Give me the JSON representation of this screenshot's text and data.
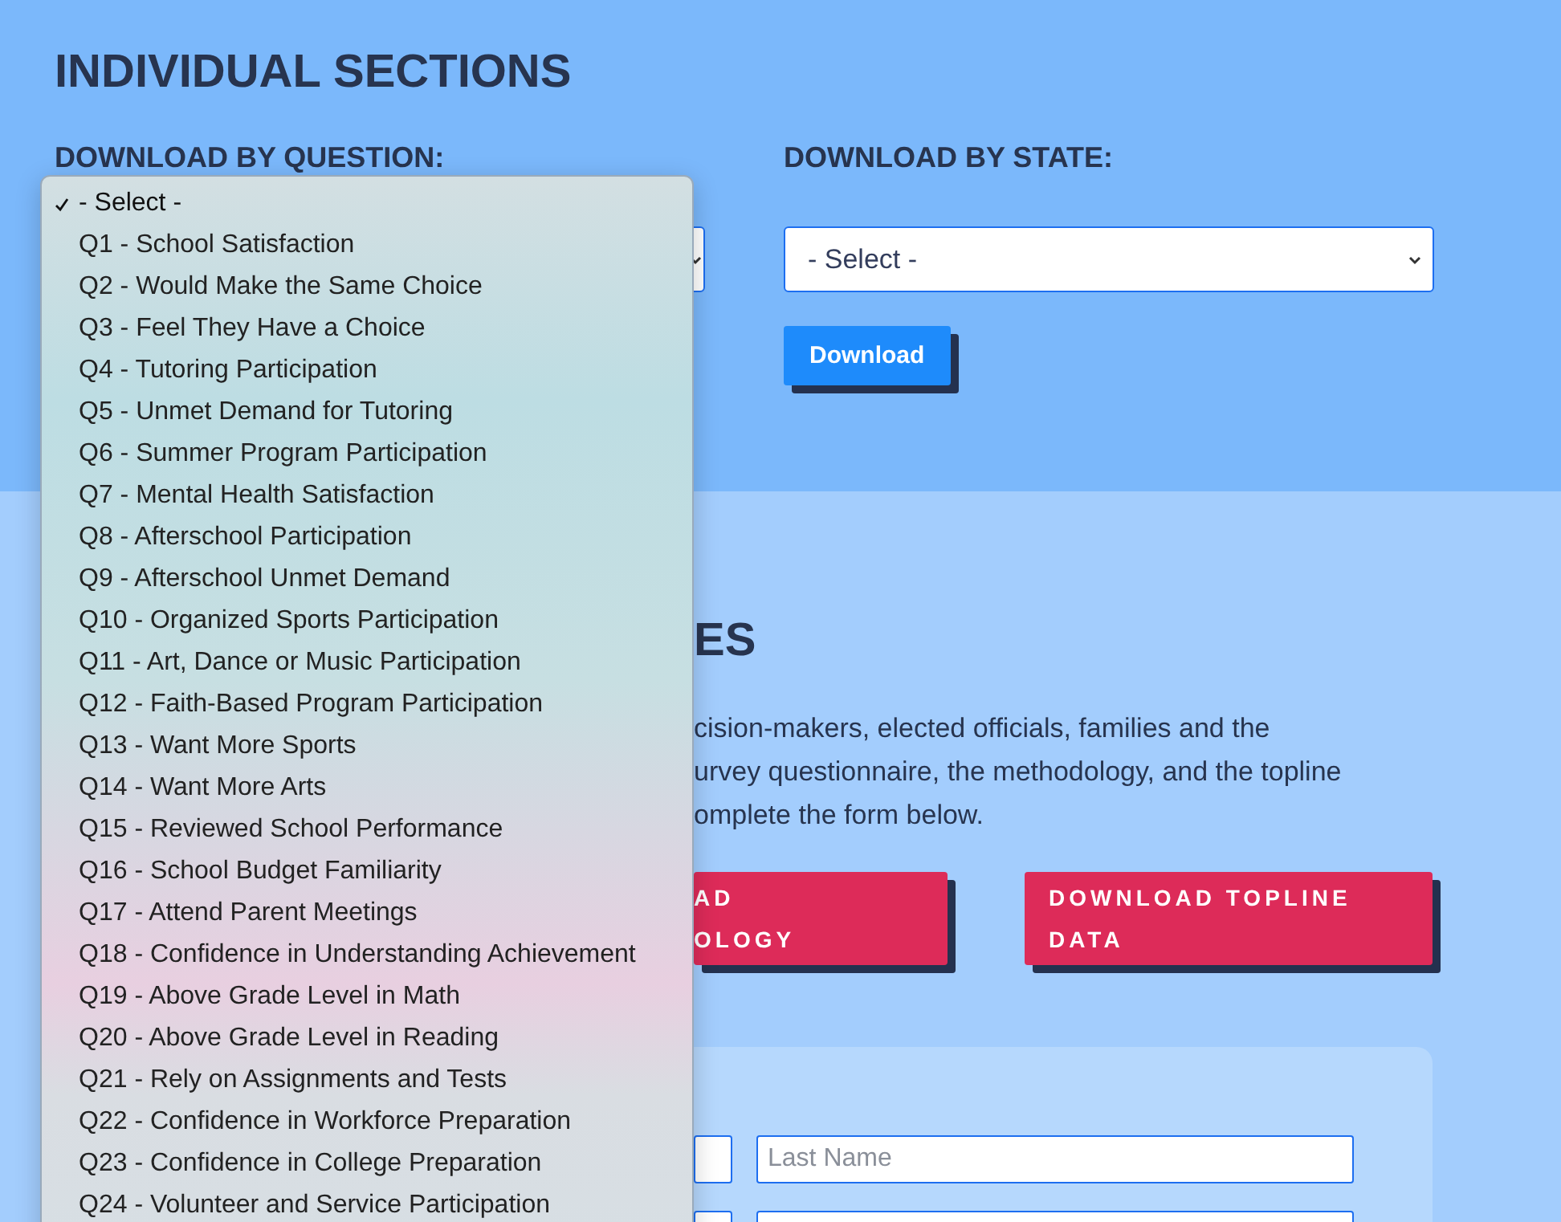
{
  "top": {
    "heading": "INDIVIDUAL SECTIONS",
    "by_question": {
      "label": "DOWNLOAD BY QUESTION:"
    },
    "by_state": {
      "label": "DOWNLOAD BY STATE:",
      "value": "- Select -",
      "button": "Download"
    }
  },
  "question_menu": {
    "options": [
      {
        "label": "- Select -",
        "selected": true
      },
      {
        "label": "Q1 - School Satisfaction",
        "selected": false
      },
      {
        "label": "Q2 - Would Make the Same Choice",
        "selected": false
      },
      {
        "label": "Q3 - Feel They Have a Choice",
        "selected": false
      },
      {
        "label": "Q4 - Tutoring Participation",
        "selected": false
      },
      {
        "label": "Q5 - Unmet Demand for Tutoring",
        "selected": false
      },
      {
        "label": "Q6 - Summer Program Participation",
        "selected": false
      },
      {
        "label": "Q7 - Mental Health Satisfaction",
        "selected": false
      },
      {
        "label": "Q8 - Afterschool Participation",
        "selected": false
      },
      {
        "label": "Q9 - Afterschool Unmet Demand",
        "selected": false
      },
      {
        "label": "Q10 - Organized Sports Participation",
        "selected": false
      },
      {
        "label": "Q11 - Art, Dance or Music Participation",
        "selected": false
      },
      {
        "label": "Q12 - Faith-Based Program Participation",
        "selected": false
      },
      {
        "label": "Q13 - Want More Sports",
        "selected": false
      },
      {
        "label": "Q14 - Want More Arts",
        "selected": false
      },
      {
        "label": "Q15 - Reviewed School Performance",
        "selected": false
      },
      {
        "label": "Q16 - School Budget Familiarity",
        "selected": false
      },
      {
        "label": "Q17 - Attend Parent Meetings",
        "selected": false
      },
      {
        "label": "Q18 - Confidence in Understanding Achievement",
        "selected": false
      },
      {
        "label": "Q19 - Above Grade Level in Math",
        "selected": false
      },
      {
        "label": "Q20 - Above Grade Level in Reading",
        "selected": false
      },
      {
        "label": "Q21 - Rely on Assignments and Tests",
        "selected": false
      },
      {
        "label": "Q22 - Confidence in Workforce Preparation",
        "selected": false
      },
      {
        "label": "Q23 - Confidence in College Preparation",
        "selected": false
      },
      {
        "label": "Q24 - Volunteer and Service Participation",
        "selected": false
      }
    ]
  },
  "lower": {
    "heading": "ES",
    "paragraph_lines": [
      "cision-makers, elected officials, families and the",
      "urvey questionnaire, the methodology, and the topline",
      "omplete the form below."
    ],
    "buttons": [
      {
        "lines": [
          "AD",
          "OLOGY"
        ]
      },
      {
        "lines": [
          "DOWNLOAD TOPLINE",
          "DATA"
        ]
      }
    ],
    "form": {
      "fields": [
        {
          "placeholder": "Last Name"
        }
      ]
    }
  }
}
